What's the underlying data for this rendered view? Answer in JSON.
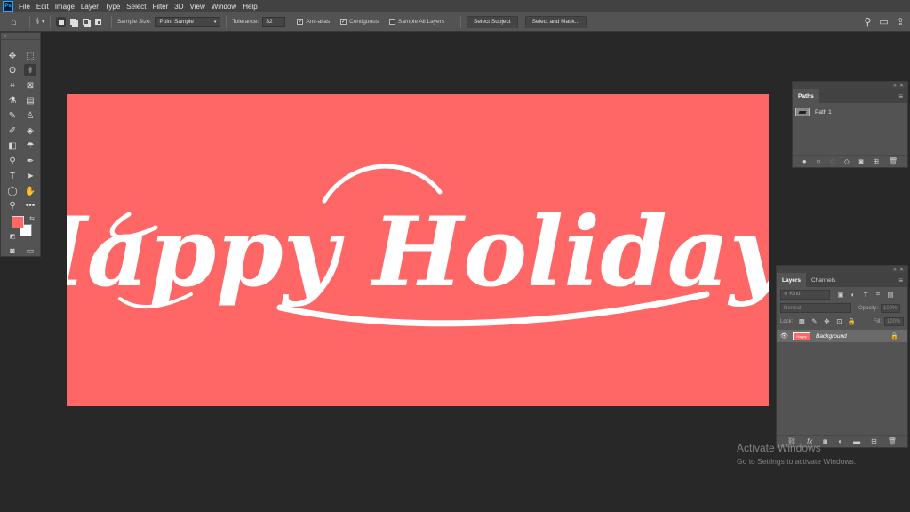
{
  "app": {
    "logo": "Ps"
  },
  "menu": [
    "File",
    "Edit",
    "Image",
    "Layer",
    "Type",
    "Select",
    "Filter",
    "3D",
    "View",
    "Window",
    "Help"
  ],
  "options": {
    "sample_size_label": "Sample Size:",
    "sample_size_value": "Point Sample",
    "tolerance_label": "Tolerance:",
    "tolerance_value": "32",
    "anti_alias": "Anti-alias",
    "contiguous": "Contiguous",
    "sample_all_layers": "Sample All Layers",
    "select_subject": "Select Subject",
    "select_and_mask": "Select and Mask..."
  },
  "canvas": {
    "text": "Happy Holidays",
    "bg_color": "#ff6666",
    "text_color": "#ffffff"
  },
  "colors": {
    "foreground": "#ff6666",
    "background": "#ffffff"
  },
  "paths_panel": {
    "tab": "Paths",
    "items": [
      {
        "label": "Path 1"
      }
    ]
  },
  "layers_panel": {
    "tabs": [
      "Layers",
      "Channels"
    ],
    "kind_placeholder": "Kind",
    "blend_mode": "Normal",
    "opacity_label": "Opacity:",
    "opacity_value": "100%",
    "lock_label": "Lock:",
    "fill_label": "Fill:",
    "fill_value": "100%",
    "layers": [
      {
        "name": "Background",
        "thumb_text": "Happy"
      }
    ]
  },
  "watermark": {
    "title": "Activate Windows",
    "subtitle": "Go to Settings to activate Windows."
  }
}
